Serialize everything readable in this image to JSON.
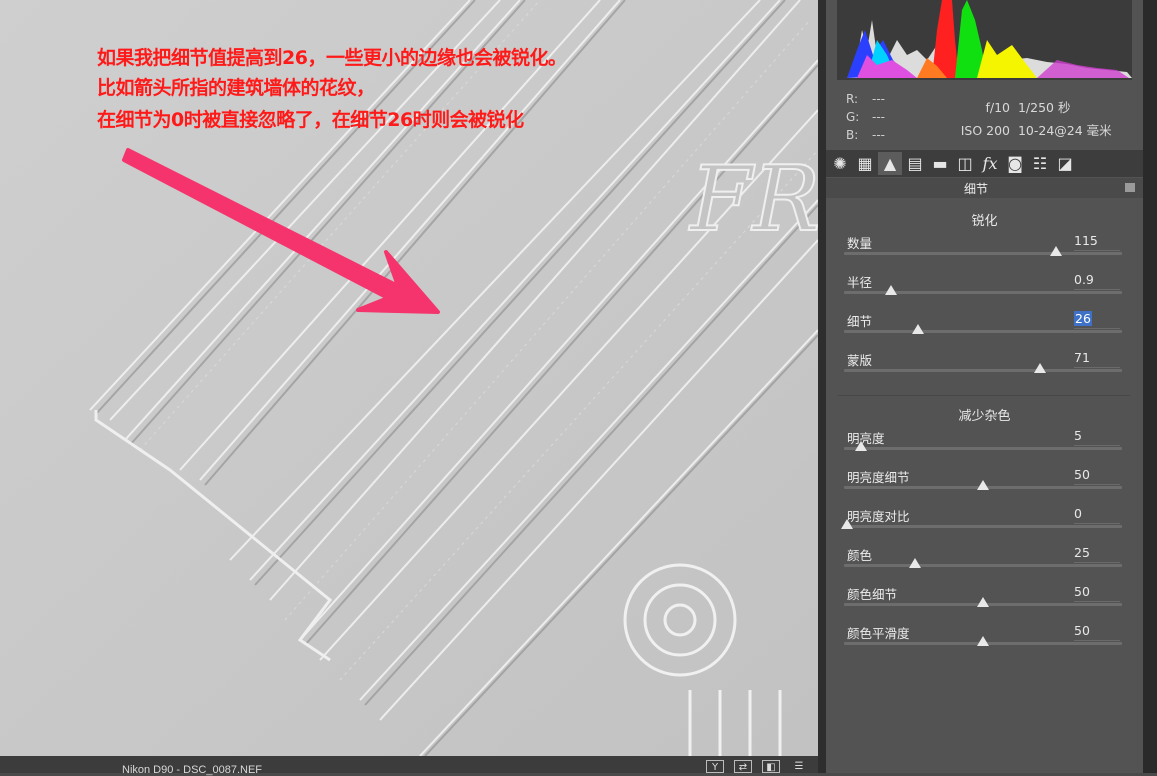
{
  "annotation": {
    "lines": [
      "如果我把细节值提高到26，一些更小的边缘也会被锐化。",
      "比如箭头所指的建筑墙体的花纹，",
      "在细节为0时被直接忽略了，在细节26时则会被锐化"
    ],
    "color": "#ff1a1a",
    "arrow_color": "#f5336c"
  },
  "statusbar": {
    "filename": "Nikon D90 - DSC_0087.NEF",
    "buttons": [
      "Y",
      "⇄",
      "◧",
      "☰"
    ]
  },
  "histogram_info": {
    "r_label": "R:",
    "r_value": "---",
    "g_label": "G:",
    "g_value": "---",
    "b_label": "B:",
    "b_value": "---",
    "aperture": "f/10",
    "shutter": "1/250 秒",
    "iso": "ISO 200",
    "lens": "10-24@24 毫米"
  },
  "tabs": [
    {
      "icon": "aperture-icon",
      "glyph": "✺"
    },
    {
      "icon": "tone-curve-icon",
      "glyph": "▦"
    },
    {
      "icon": "detail-icon",
      "glyph": "▲"
    },
    {
      "icon": "hsl-icon",
      "glyph": "▤"
    },
    {
      "icon": "split-toning-icon",
      "glyph": "▬"
    },
    {
      "icon": "lens-corrections-icon",
      "glyph": "◫"
    },
    {
      "icon": "effects-icon",
      "glyph": "fx"
    },
    {
      "icon": "camera-calibration-icon",
      "glyph": "◙"
    },
    {
      "icon": "presets-icon",
      "glyph": "☷"
    },
    {
      "icon": "snapshots-icon",
      "glyph": "◪"
    }
  ],
  "panel": {
    "title": "细节",
    "sharpen": {
      "title": "锐化",
      "sliders": [
        {
          "label": "数量",
          "value": "115",
          "fraction": 0.77
        },
        {
          "label": "半径",
          "value": "0.9",
          "fraction": 0.16
        },
        {
          "label": "细节",
          "value": "26",
          "fraction": 0.26,
          "selected": true
        },
        {
          "label": "蒙版",
          "value": "71",
          "fraction": 0.71
        }
      ]
    },
    "noise": {
      "title": "减少杂色",
      "sliders": [
        {
          "label": "明亮度",
          "value": "5",
          "fraction": 0.05
        },
        {
          "label": "明亮度细节",
          "value": "50",
          "fraction": 0.5
        },
        {
          "label": "明亮度对比",
          "value": "0",
          "fraction": 0.0
        },
        {
          "label": "颜色",
          "value": "25",
          "fraction": 0.25
        },
        {
          "label": "颜色细节",
          "value": "50",
          "fraction": 0.5
        },
        {
          "label": "颜色平滑度",
          "value": "50",
          "fraction": 0.5
        }
      ]
    }
  },
  "colors": {
    "panel_bg": "#535353",
    "selection": "#3f72c6"
  }
}
